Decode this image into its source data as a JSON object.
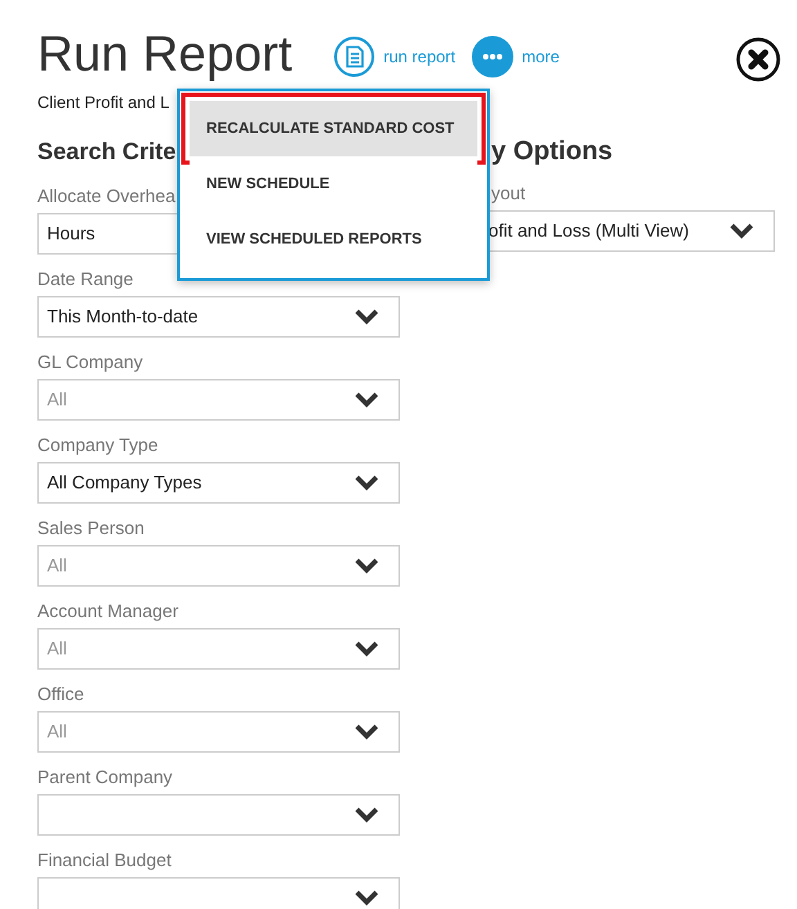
{
  "header": {
    "title": "Run Report",
    "subtitle": "Client Profit and L",
    "actions": [
      {
        "kind": "report",
        "label": "run report",
        "selected": false
      },
      {
        "kind": "more",
        "label": "more",
        "selected": true
      }
    ]
  },
  "more_menu": {
    "expanded": true,
    "items": [
      {
        "label": "RECALCULATE STANDARD COST",
        "selected": true
      },
      {
        "label": "NEW SCHEDULE",
        "selected": false
      },
      {
        "label": "VIEW SCHEDULED REPORTS",
        "selected": false
      }
    ]
  },
  "search_criteria": {
    "heading": "Search Crite",
    "fields": [
      {
        "label": "Allocate Overhea",
        "value": "Hours"
      },
      {
        "label": "Date Range",
        "value": "This Month-to-date"
      },
      {
        "label": "GL Company",
        "placeholder": "All"
      },
      {
        "label": "Company Type",
        "value": "All Company Types"
      },
      {
        "label": "Sales Person",
        "placeholder": "All"
      },
      {
        "label": "Account Manager",
        "placeholder": "All"
      },
      {
        "label": "Office",
        "placeholder": "All"
      },
      {
        "label": "Parent Company"
      },
      {
        "label": "Financial Budget"
      }
    ]
  },
  "display_options": {
    "heading": "y Options",
    "fields": [
      {
        "label": "yout",
        "value": "ofit and Loss (Multi View)"
      }
    ]
  }
}
